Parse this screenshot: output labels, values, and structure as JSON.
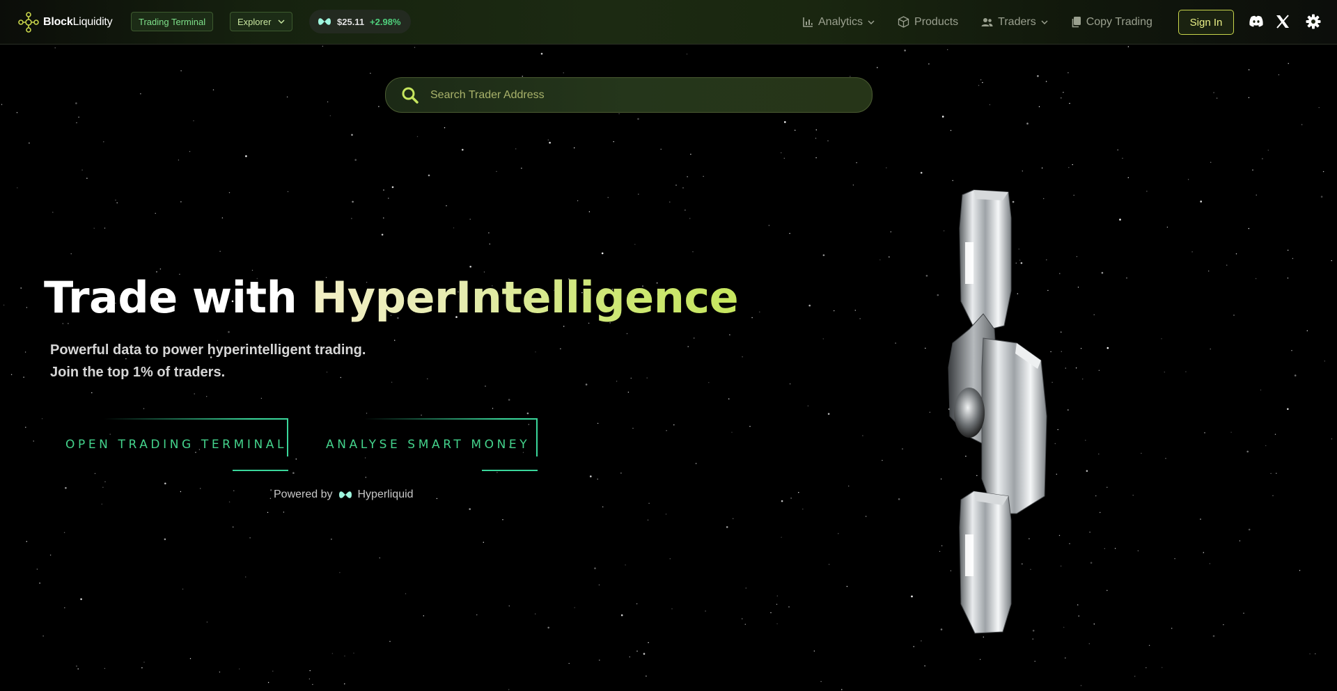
{
  "navbar": {
    "brand": {
      "bold": "Block",
      "light": "Liquidity"
    },
    "trading_terminal_label": "Trading Terminal",
    "explorer_label": "Explorer",
    "token": {
      "price": "$25.11",
      "change": "+2.98%"
    },
    "links": [
      {
        "label": "Analytics",
        "icon": "bar-chart-icon",
        "has_dropdown": true
      },
      {
        "label": "Products",
        "icon": "box-icon",
        "has_dropdown": false
      },
      {
        "label": "Traders",
        "icon": "users-icon",
        "has_dropdown": true
      },
      {
        "label": "Copy Trading",
        "icon": "copy-icon",
        "has_dropdown": false
      }
    ],
    "sign_in_label": "Sign In",
    "social_icons": [
      "discord-icon",
      "x-icon",
      "gear-icon"
    ]
  },
  "search": {
    "placeholder": "Search Trader Address"
  },
  "hero": {
    "headline_prefix": "Trade with ",
    "headline_highlight": "HyperIntelligence",
    "subtitle_line1": "Powerful data to power hyperintelligent trading.",
    "subtitle_line2": "Join the top 1% of traders.",
    "cta_terminal": "OPEN TRADING TERMINAL",
    "cta_analyse": "ANALYSE SMART MONEY",
    "powered_by_label": "Powered by",
    "powered_by_brand": "Hyperliquid"
  },
  "colors": {
    "accent_green": "#44d38c",
    "accent_yellow": "#c6e65e",
    "positive_change": "#4fd07c",
    "background": "#000000"
  }
}
